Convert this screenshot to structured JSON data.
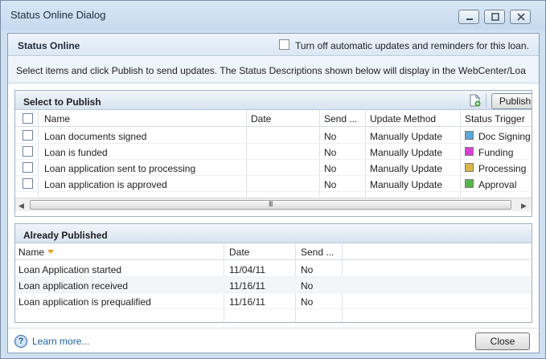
{
  "window": {
    "title": "Status Online Dialog"
  },
  "header": {
    "title": "Status Online",
    "auto_updates_label": "Turn off automatic updates and reminders for this loan."
  },
  "instructions": "Select items and click Publish to send updates. The Status Descriptions shown below will display in the WebCenter/Loa",
  "select_panel": {
    "title": "Select to Publish",
    "publish_label": "Publish",
    "columns": {
      "name": "Name",
      "date": "Date",
      "send": "Send ...",
      "method": "Update Method",
      "trigger": "Status Trigger"
    },
    "rows": [
      {
        "name": "Loan documents signed",
        "date": "",
        "send": "No",
        "method": "Manually Update",
        "trigger": "Doc Signing",
        "color": "#5aa7d8"
      },
      {
        "name": "Loan is funded",
        "date": "",
        "send": "No",
        "method": "Manually Update",
        "trigger": "Funding",
        "color": "#d63fd0"
      },
      {
        "name": "Loan application sent to processing",
        "date": "",
        "send": "No",
        "method": "Manually Update",
        "trigger": "Processing",
        "color": "#d9b54a"
      },
      {
        "name": "Loan application is approved",
        "date": "",
        "send": "No",
        "method": "Manually Update",
        "trigger": "Approval",
        "color": "#56b64b"
      }
    ],
    "scroll_grip": "III"
  },
  "published_panel": {
    "title": "Already Published",
    "columns": {
      "name": "Name",
      "date": "Date",
      "send": "Send ..."
    },
    "rows": [
      {
        "name": "Loan Application started",
        "date": "11/04/11",
        "send": "No"
      },
      {
        "name": "Loan application received",
        "date": "11/16/11",
        "send": "No"
      },
      {
        "name": "Loan application is prequalified",
        "date": "11/16/11",
        "send": "No"
      }
    ]
  },
  "footer": {
    "help_glyph": "?",
    "learn_more": "Learn more...",
    "close_label": "Close"
  }
}
